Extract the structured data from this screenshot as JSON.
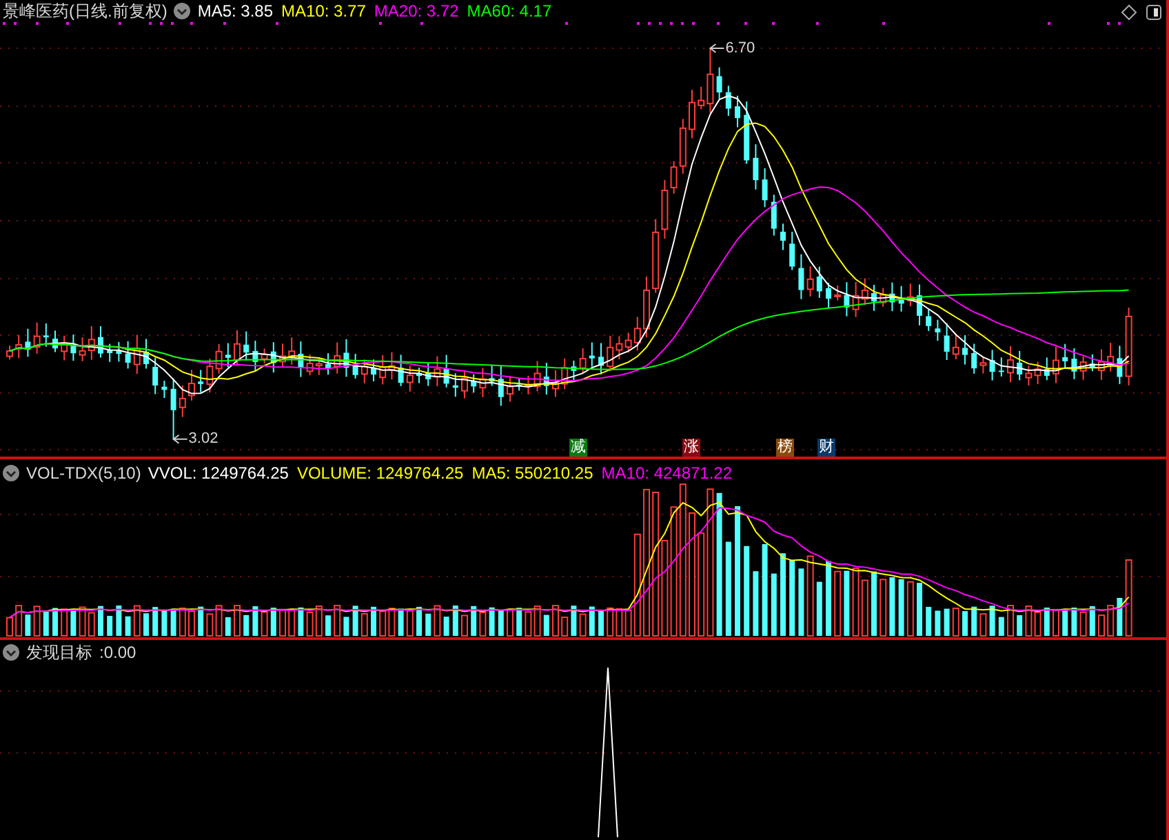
{
  "title": {
    "name": "景峰医药",
    "period": "(日线.前复权)"
  },
  "ma_legend": [
    {
      "label": "MA5: 3.85",
      "color": "#ffffff"
    },
    {
      "label": "MA10: 3.77",
      "color": "#ffff00"
    },
    {
      "label": "MA20: 3.72",
      "color": "#ff00ff"
    },
    {
      "label": "MA60: 4.17",
      "color": "#00ff00"
    }
  ],
  "price_marks": [
    {
      "kind": "high",
      "label": "6.70"
    },
    {
      "kind": "low",
      "label": "3.02"
    }
  ],
  "event_tags": [
    {
      "label": "减",
      "color": "#0a7a12"
    },
    {
      "label": "涨",
      "color": "#8a0a12"
    },
    {
      "label": "榜",
      "color": "#8a4a0a"
    },
    {
      "label": "财",
      "color": "#0a3a6a"
    }
  ],
  "volume_panel": {
    "title": "VOL-TDX(5,10)",
    "readings": [
      {
        "label": "VVOL: 1249764.25",
        "color": "#ffffff"
      },
      {
        "label": "VOLUME: 1249764.25",
        "color": "#ffff00"
      },
      {
        "label": "MA5: 550210.25",
        "color": "#ffff00"
      },
      {
        "label": "MA10: 424871.22",
        "color": "#ff00ff"
      }
    ]
  },
  "indicator_panel": {
    "title": "发现目标",
    "reading": ":0.00"
  }
}
